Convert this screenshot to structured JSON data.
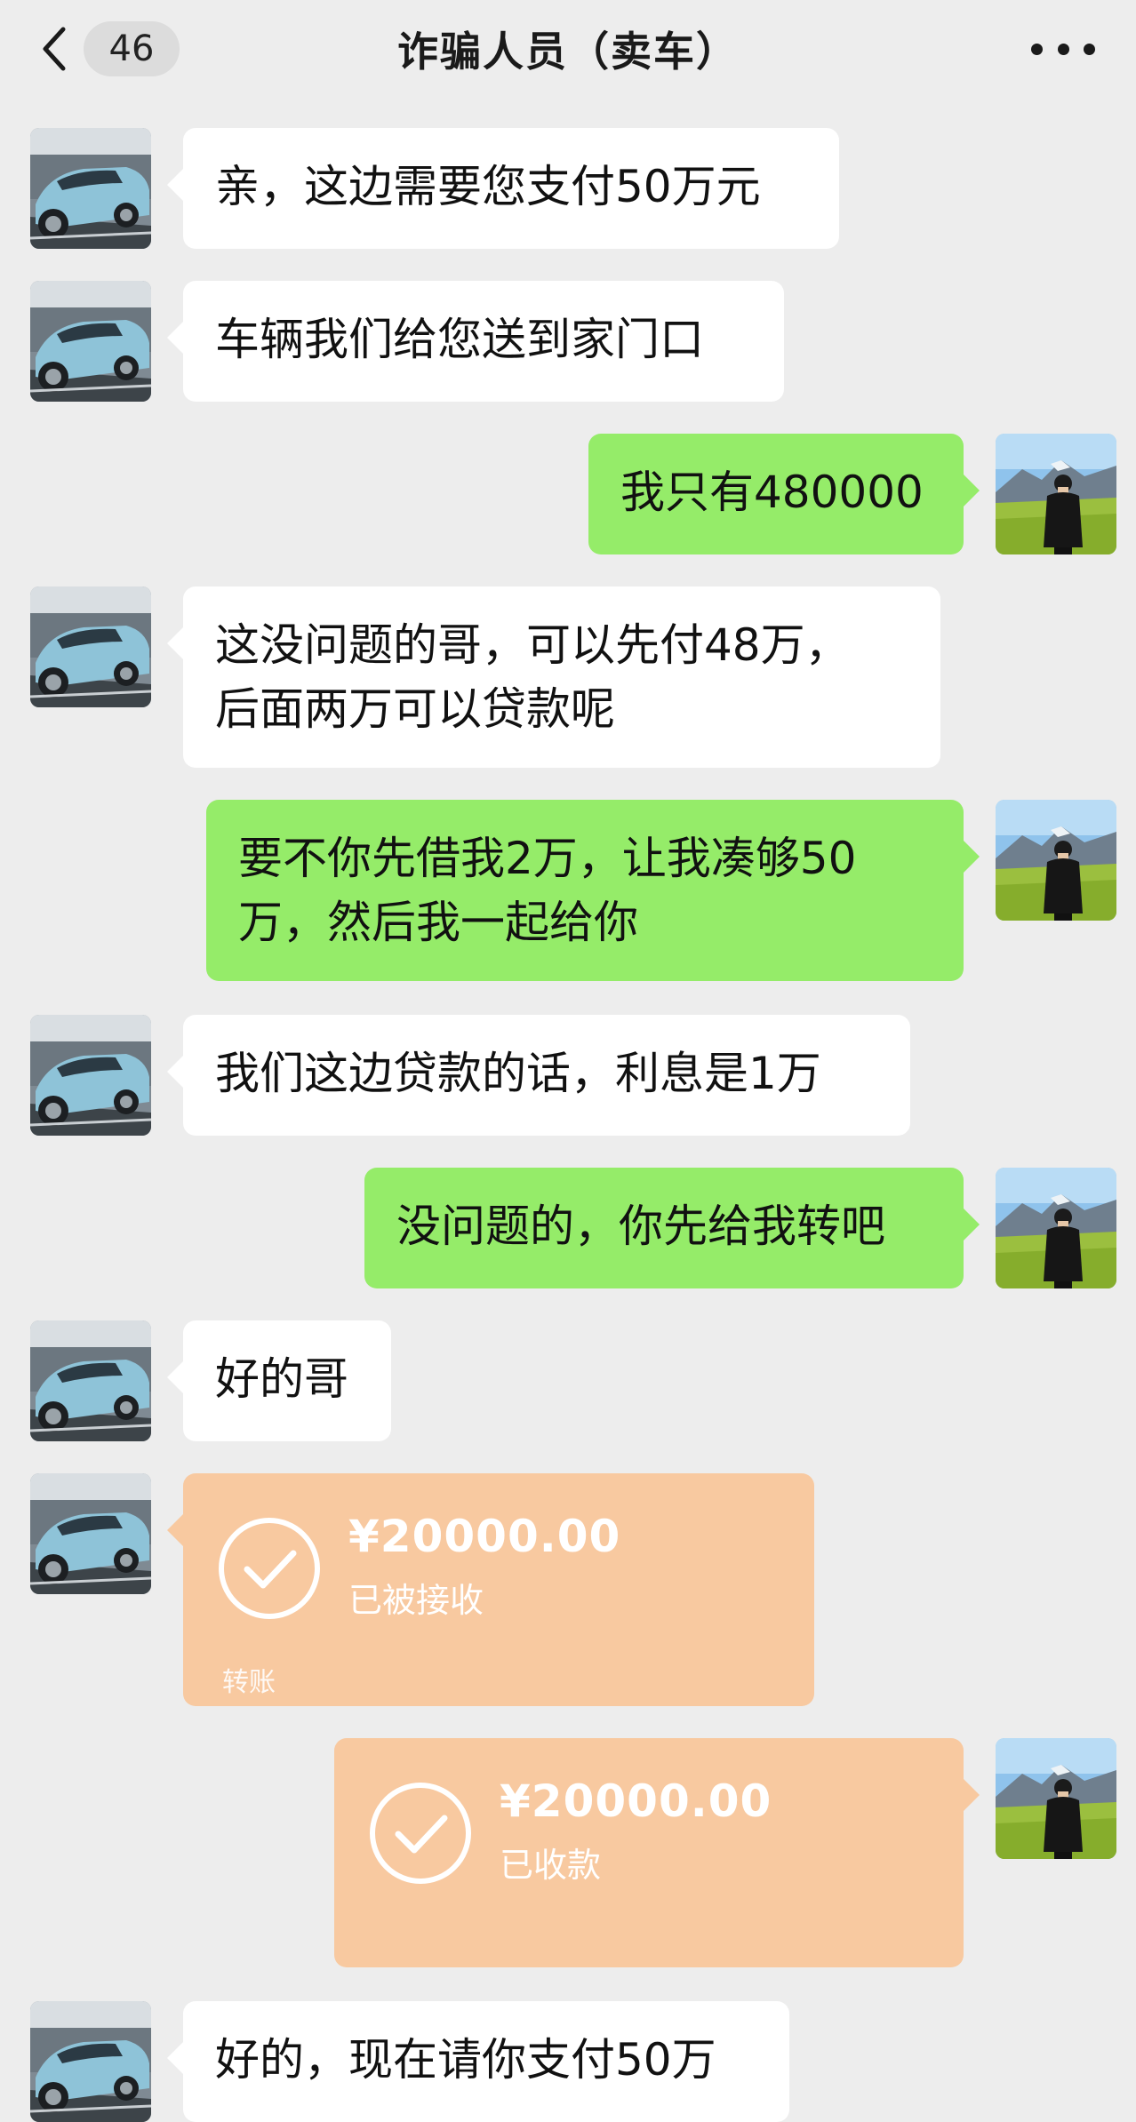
{
  "header": {
    "unread_count": "46",
    "title": "诈骗人员（卖车）"
  },
  "messages": [
    {
      "from": "seller",
      "text": "亲，这边需要您支付50万元"
    },
    {
      "from": "seller",
      "text": "车辆我们给您送到家门口"
    },
    {
      "from": "me",
      "text": "我只有480000"
    },
    {
      "from": "seller",
      "line1": "这没问题的哥，可以先付48万，",
      "line2": "后面两万可以贷款呢"
    },
    {
      "from": "me",
      "line1": "要不你先借我2万，让我凑够50",
      "line2": "万，然后我一起给你"
    },
    {
      "from": "seller",
      "text": "我们这边贷款的话，利息是1万"
    },
    {
      "from": "me",
      "text": "没问题的，你先给我转吧"
    },
    {
      "from": "seller",
      "text": "好的哥"
    },
    {
      "from": "seller",
      "type": "transfer",
      "amount": "¥20000.00",
      "status": "已被接收",
      "footer": "转账"
    },
    {
      "from": "me",
      "type": "transfer",
      "amount": "¥20000.00",
      "status": "已收款"
    },
    {
      "from": "seller",
      "text": "好的，现在请你支付50万"
    }
  ],
  "colors": {
    "background": "#ededed",
    "incoming_bubble": "#ffffff",
    "outgoing_bubble": "#95ec69",
    "transfer_card": "#f8c9a0"
  },
  "icons": {
    "back": "chevron-left-icon",
    "more": "more-dots-icon",
    "transfer_done": "check-circle-icon"
  }
}
